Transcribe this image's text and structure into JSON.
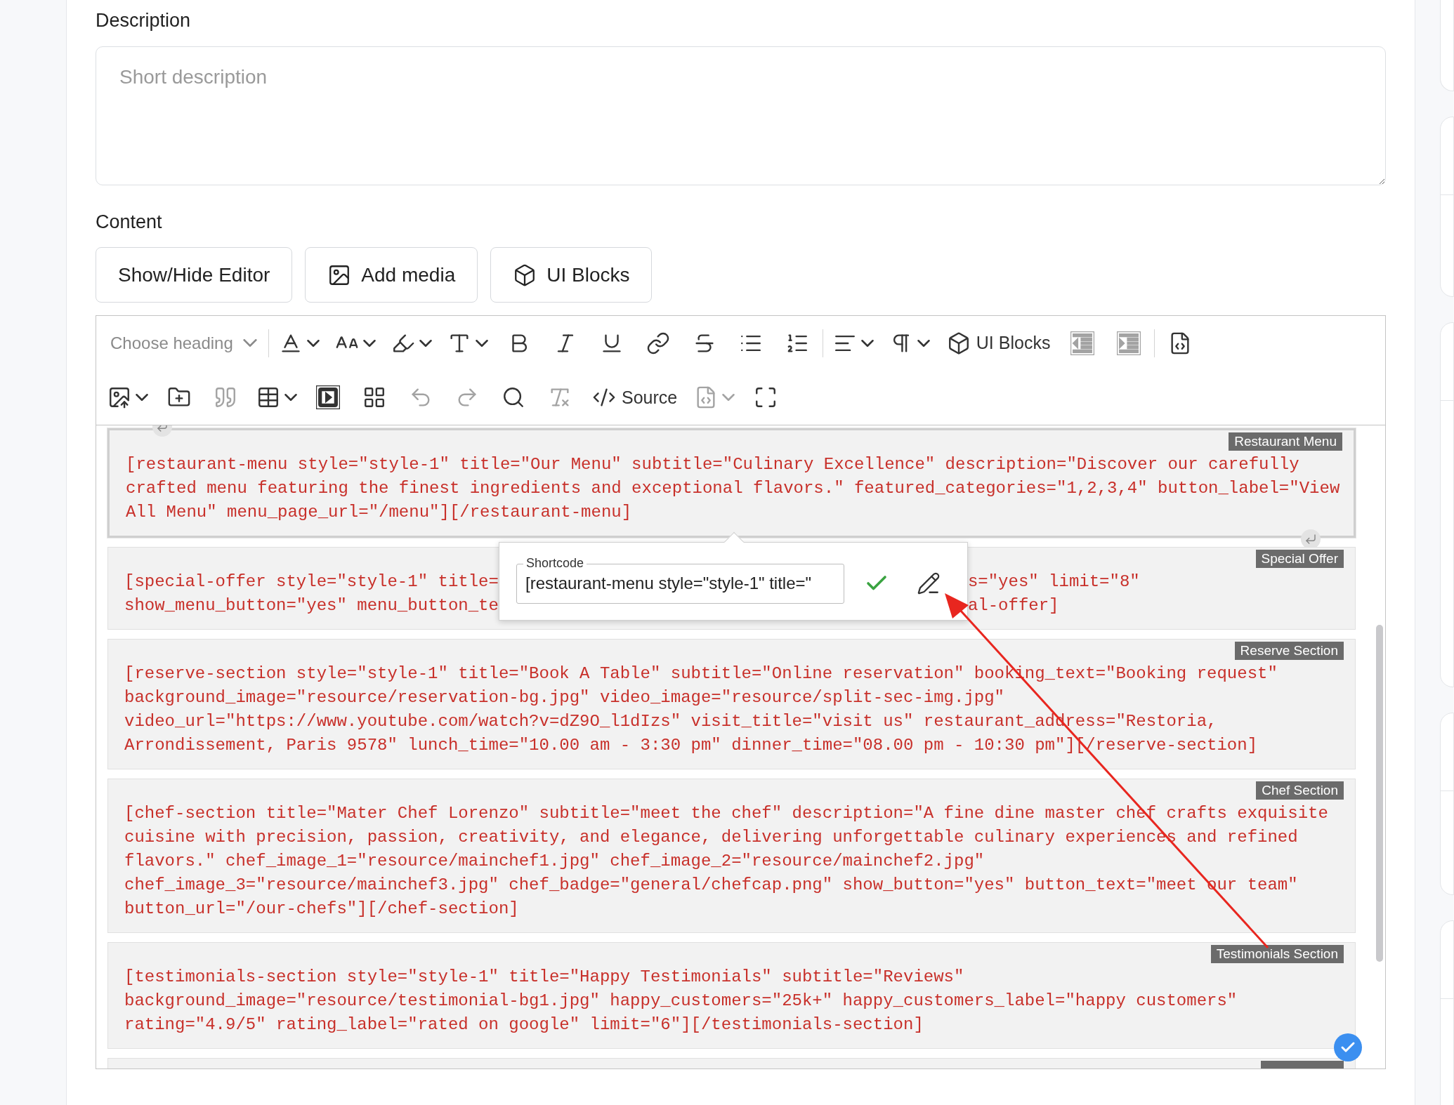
{
  "description": {
    "label": "Description",
    "placeholder": "Short description"
  },
  "content": {
    "label": "Content",
    "buttons": [
      "Show/Hide Editor",
      "Add media",
      "UI Blocks"
    ]
  },
  "toolbar": {
    "row1": [
      [
        {
          "kind": "dropdown",
          "label": "Choose heading",
          "disabled": false
        }
      ],
      [
        {
          "kind": "icon_dropdown",
          "disabled": false
        },
        {
          "kind": "icon_dropdown",
          "disabled": false
        },
        {
          "kind": "icon_dropdown",
          "disabled": false
        },
        {
          "kind": "icon_dropdown",
          "disabled": false
        },
        {
          "kind": "icon",
          "disabled": false
        },
        {
          "kind": "icon",
          "disabled": false
        },
        {
          "kind": "icon",
          "disabled": false
        },
        {
          "kind": "icon",
          "disabled": false
        },
        {
          "kind": "icon",
          "disabled": false
        },
        {
          "kind": "icon",
          "disabled": false
        },
        {
          "kind": "icon",
          "disabled": false
        }
      ],
      [
        {
          "kind": "icon_dropdown",
          "disabled": false
        },
        {
          "kind": "icon_dropdown",
          "disabled": false
        },
        {
          "kind": "icon_text",
          "label": "UI Blocks",
          "disabled": false
        },
        {
          "kind": "icon",
          "disabled": true
        },
        {
          "kind": "icon",
          "disabled": true
        }
      ],
      [
        {
          "kind": "icon",
          "disabled": false
        }
      ]
    ],
    "row2": [
      {
        "kind": "icon_dropdown",
        "disabled": false
      },
      {
        "kind": "icon",
        "disabled": false
      },
      {
        "kind": "icon",
        "disabled": true
      },
      {
        "kind": "icon_dropdown",
        "disabled": false
      },
      {
        "kind": "icon",
        "disabled": false
      },
      {
        "kind": "icon",
        "disabled": false
      },
      {
        "kind": "icon",
        "disabled": true
      },
      {
        "kind": "icon",
        "disabled": true
      },
      {
        "kind": "icon",
        "disabled": false
      },
      {
        "kind": "icon",
        "disabled": true
      },
      {
        "kind": "icon_text",
        "label": "Source",
        "disabled": false
      },
      {
        "kind": "icon_dropdown",
        "disabled": true
      },
      {
        "kind": "icon",
        "disabled": false
      }
    ]
  },
  "blocks": [
    {
      "label": "Restaurant Menu",
      "selected": true,
      "kind": "text",
      "lines": [
        "[restaurant-menu style=\"style-1\" title=\"Our Menu\" subtitle=\"Culinary Excellence\" description=\"Discover our carefully",
        "crafted menu featuring the finest ingredients and exceptional flavors.\" featured_categories=\"1,2,3,4\" button_label=\"View",
        "All Menu\" menu_page_url=\"/menu\"][/restaurant-menu]"
      ]
    },
    {
      "label": "Special Offer",
      "selected": false,
      "kind": "split",
      "lines": [
        [
          "[special-offer style=\"style-1\" title=",
          "s=\"yes\" limit=\"8\""
        ],
        [
          "show_menu_button=\"yes\" menu_button_te",
          "al-offer]"
        ]
      ]
    },
    {
      "label": "Reserve Section",
      "selected": false,
      "kind": "text",
      "lines": [
        "[reserve-section style=\"style-1\" title=\"Book A Table\" subtitle=\"Online reservation\" booking_text=\"Booking request\"",
        "background_image=\"resource/reservation-bg.jpg\" video_image=\"resource/split-sec-img.jpg\"",
        "video_url=\"https://www.youtube.com/watch?v=dZ9O_l1dIzs\" visit_title=\"visit us\" restaurant_address=\"Restoria,",
        "Arrondissement, Paris 9578\" lunch_time=\"10.00 am - 3:30 pm\" dinner_time=\"08.00 pm - 10:30 pm\"][/reserve-section]"
      ]
    },
    {
      "label": "Chef Section",
      "selected": false,
      "kind": "text",
      "lines": [
        "[chef-section title=\"Mater Chef Lorenzo\" subtitle=\"meet the chef\" description=\"A fine dine master chef crafts exquisite",
        "cuisine with precision, passion, creativity, and elegance, delivering unforgettable culinary experiences and refined",
        "flavors.\" chef_image_1=\"resource/mainchef1.jpg\" chef_image_2=\"resource/mainchef2.jpg\"",
        "chef_image_3=\"resource/mainchef3.jpg\" chef_badge=\"general/chefcap.png\" show_button=\"yes\" button_text=\"meet our team\"",
        "button_url=\"/our-chefs\"][/chef-section]"
      ]
    },
    {
      "label": "Testimonials Section",
      "selected": false,
      "kind": "text",
      "lines": [
        "[testimonials-section style=\"style-1\" title=\"Happy Testimonials\" subtitle=\"Reviews\"",
        "background_image=\"resource/testimonial-bg1.jpg\" happy_customers=\"25k+\" happy_customers_label=\"happy customers\"",
        "rating=\"4.9/5\" rating_label=\"rated on google\" limit=\"6\"][/testimonials-section]"
      ]
    }
  ],
  "popup": {
    "field_label": "Shortcode",
    "value": "[restaurant-menu style=\"style-1\" title=\""
  }
}
